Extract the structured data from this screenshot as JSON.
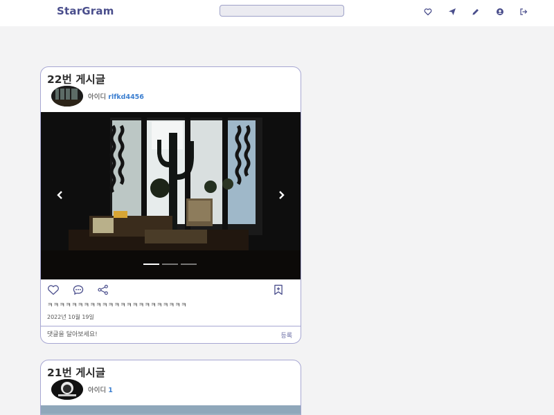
{
  "app": {
    "logo": "StarGram",
    "search": {
      "value": "",
      "placeholder": ""
    },
    "nav": [
      {
        "name": "heart-icon",
        "label": "좋아요"
      },
      {
        "name": "send-icon",
        "label": "메시지"
      },
      {
        "name": "pencil-icon",
        "label": "글쓰기"
      },
      {
        "name": "user-circle-icon",
        "label": "프로필"
      },
      {
        "name": "logout-icon",
        "label": "로그아웃"
      }
    ]
  },
  "colors": {
    "brand": "#4a4e8c",
    "card_border": "#a6a6d2",
    "user_link": "#3c7fd0",
    "icon": "#4a4e8c"
  },
  "posts": [
    {
      "title": "22번 게시글",
      "author_label": "아이디",
      "author_id": "rlfkd4456",
      "caption": "ㅋㅋㅋㅋㅋㅋㅋㅋㅋㅋㅋㅋㅋㅋㅋㅋㅋㅋㅋㅋㅋㅋㅋ",
      "date": "2022년 10월 19일",
      "comment_placeholder": "댓글을 달아보세요!",
      "submit_label": "등록",
      "carousel_slides": 3,
      "carousel_active": 1
    },
    {
      "title": "21번 게시글",
      "author_label": "아이디",
      "author_id": "1"
    }
  ]
}
